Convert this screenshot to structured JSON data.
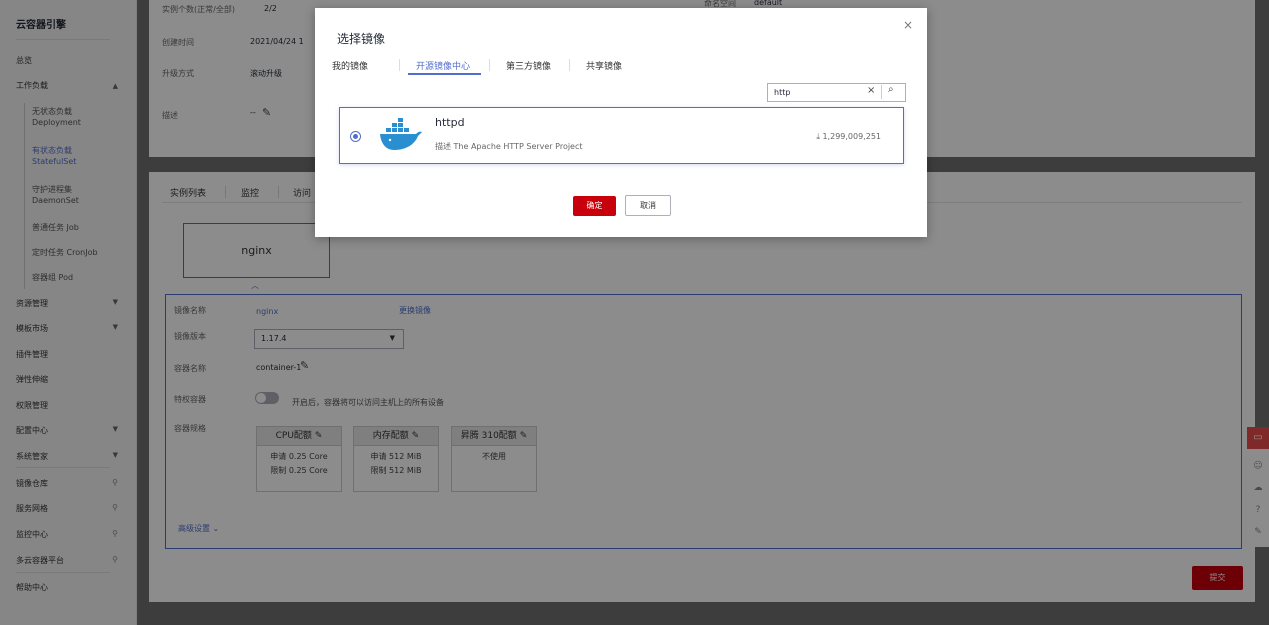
{
  "sidebar": {
    "title": "云容器引擎",
    "overview": "总览",
    "workload": "工作负载",
    "sub": [
      {
        "zh": "无状态负载",
        "en": "Deployment"
      },
      {
        "zh": "有状态负载",
        "en": "StatefulSet"
      },
      {
        "zh": "守护进程集",
        "en": "DaemonSet"
      },
      {
        "zh": "普通任务 Job"
      },
      {
        "zh": "定时任务 CronJob"
      },
      {
        "zh": "容器组 Pod"
      }
    ],
    "items": [
      "资源管理",
      "模板市场",
      "插件管理",
      "弹性伸缩",
      "权限管理",
      "配置中心",
      "系统管家",
      "镜像仓库",
      "服务网格",
      "监控中心",
      "多云容器平台",
      "帮助中心"
    ]
  },
  "info": {
    "instances_label": "实例个数(正常/全部)",
    "instances_value": "2/2",
    "ns_label": "命名空间",
    "ns_value": "default",
    "created_label": "创建时间",
    "created_value": "2021/04/24 1",
    "upgrade_label": "升级方式",
    "upgrade_value": "滚动升级",
    "desc_label": "描述",
    "desc_value": "--"
  },
  "tabs": [
    "实例列表",
    "监控",
    "访问"
  ],
  "container": {
    "name": "nginx",
    "image_name_label": "镜像名称",
    "image_name_value": "nginx",
    "change_image": "更换镜像",
    "image_version_label": "镜像版本",
    "image_version_value": "1.17.4",
    "container_name_label": "容器名称",
    "container_name_value": "container-1",
    "privileged_label": "特权容器",
    "privileged_hint": "开启后，容器将可以访问主机上的所有设备",
    "spec_label": "容器规格",
    "quotas": [
      {
        "title": "CPU配额",
        "l1": "申请 0.25 Core",
        "l2": "限制 0.25 Core"
      },
      {
        "title": "内存配额",
        "l1": "申请 512 MiB",
        "l2": "限制 512 MiB"
      },
      {
        "title": "昇腾 310配额",
        "l1": "不使用",
        "l2": ""
      }
    ],
    "advanced": "高级设置"
  },
  "submit": "提交",
  "modal": {
    "title": "选择镜像",
    "tabs": [
      "我的镜像",
      "开源镜像中心",
      "第三方镜像",
      "共享镜像"
    ],
    "search_value": "http",
    "result": {
      "name": "httpd",
      "desc": "描述 The Apache HTTP Server Project",
      "downloads": "1,299,009,251"
    },
    "confirm": "确定",
    "cancel": "取消"
  },
  "colors": {
    "accent": "#526ecc",
    "primary_red": "#c7000b"
  },
  "icons": [
    "close-icon",
    "search-icon",
    "clear-icon",
    "edit-icon",
    "download-icon",
    "docker-logo",
    "chevron-down-icon",
    "chevron-up-icon",
    "link-icon"
  ]
}
